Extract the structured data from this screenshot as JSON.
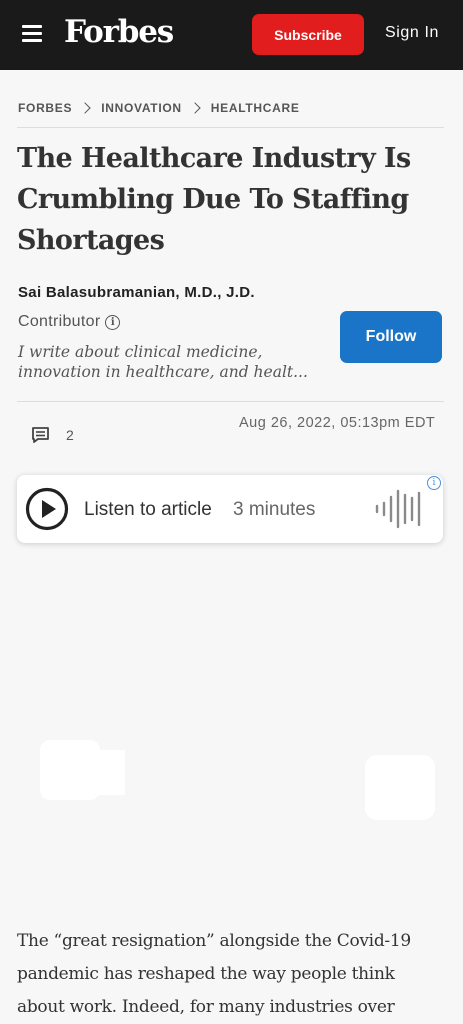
{
  "header": {
    "logo": "Forbes",
    "subscribe_label": "Subscribe",
    "signin_label": "Sign In",
    "menu_icon": "hamburger-menu-icon",
    "colors": {
      "bar": "#1a1a1a",
      "subscribe": "#e11d1d"
    }
  },
  "breadcrumb": [
    "FORBES",
    "INNOVATION",
    "HEALTHCARE"
  ],
  "article": {
    "headline": "The Healthcare Industry Is Crumbling Due To Staffing Shortages",
    "author": {
      "name": "Sai Balasubramanian, M.D., J.D.",
      "role": "Contributor",
      "bio": "I write about clinical medicine, innovation in healthcare, and healt...",
      "follow_label": "Follow",
      "follow_color": "#1a75c9"
    },
    "comment_count": "2",
    "date": "Aug 26, 2022, 05:13pm EDT",
    "audio": {
      "label": "Listen to article",
      "duration": "3 minutes",
      "ad_info": "i"
    },
    "body": "The “great resignation” alongside the Covid-19 pandemic has reshaped the way people think about work. Indeed, for many industries over"
  }
}
